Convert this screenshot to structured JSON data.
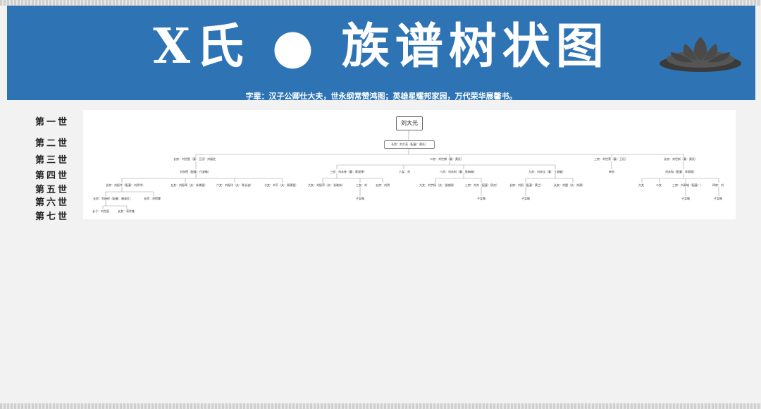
{
  "header": {
    "title": "X氏 ● 族谱树状图",
    "subtitle": "字辈：汉子公卿仕大夫，世永纲常赞鸿图；英雄星耀邦家园，万代荣华展馨书。"
  },
  "generations": [
    "第一世",
    "第二世",
    "第三世",
    "第四世",
    "第五世",
    "第六世",
    "第七世"
  ],
  "tree": {
    "root": "刘大光",
    "gen2": "长男：刘大亮（配妻：黄氏）",
    "gen3": [
      "长房：刘世智（妻：王氏）刘福芝",
      "二房：刘世博（妻：黄氏）",
      "三房：刘世荣（妻：王氏）",
      "长房：刘世新（妻：黄氏）"
    ],
    "gen4": [
      "刘永德（配妻：付淑敏）",
      "三房：刘永林（妻：蔡淑琴）",
      "六女：刘",
      "八房：刘永财（妻：陈梅梅）",
      "九房：刘永佳（妻：丁淑敏）",
      "单房",
      "刘永和（配妻：李丽丽）"
    ],
    "gen5": [
      "长房：刘振华（配妻：刘秀华）",
      "五女：刘振琴（夫：朱晓强）",
      "六女：刘振玲（夫：陈永波）",
      "七女：刘平（夫：周建强）",
      "大女：刘振萍（夫：张晓伟）",
      "三女：刘",
      "五房：刘明",
      "大女：刘宇杨（夫：张晓刚）",
      "三房：刘杰（配妻：邢杰）",
      "长房：刘凯（配妻：黄兰）",
      "长女：刘霞（夫：刘建）",
      "大女",
      "二女",
      "三房：刘青城（配妻：）",
      "四房：刘"
    ],
    "gen6": [
      "长房：刘继祥（配妻：唐淑红）",
      "长房：刘得霖",
      "子女略",
      "子女略",
      "子女略",
      "子女略",
      "子女略"
    ],
    "gen7": [
      "长子：刘世昌",
      "长女：蒋玲美"
    ]
  }
}
